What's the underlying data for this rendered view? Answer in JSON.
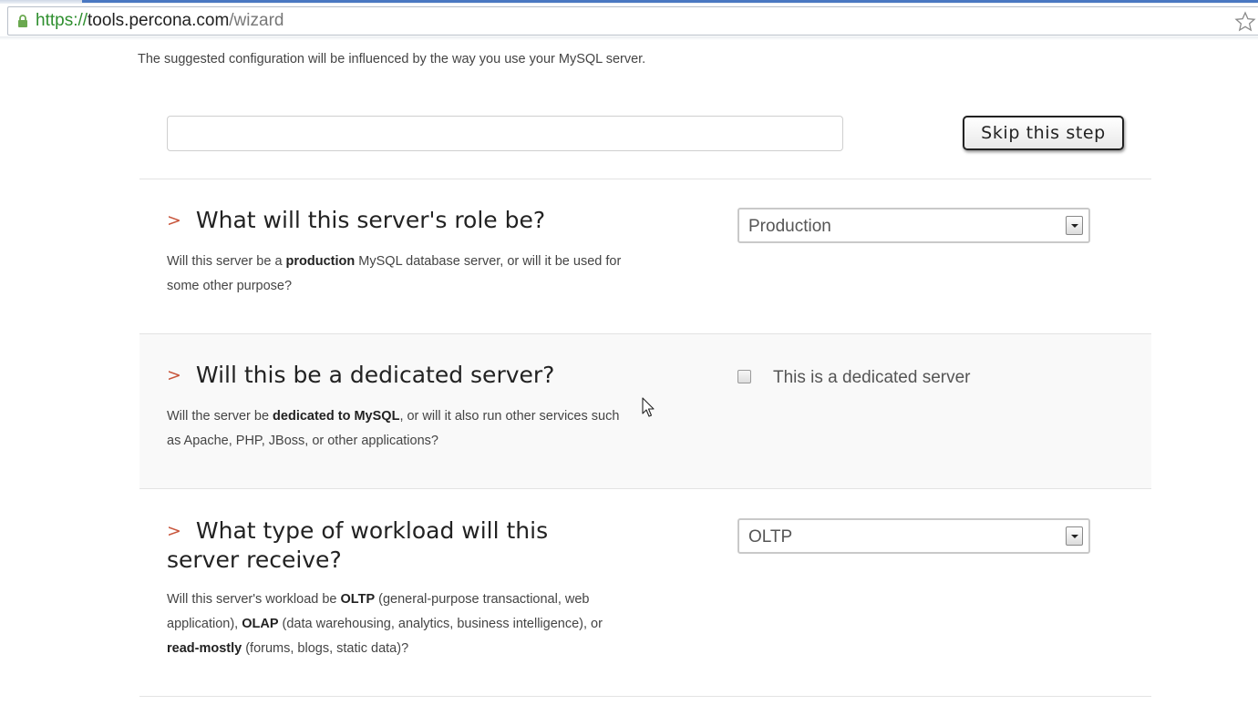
{
  "browser": {
    "url_scheme": "https://",
    "url_host": "tools.percona.com",
    "url_path": "/wizard"
  },
  "intro_text": "The suggested configuration will be influenced by the way you use your MySQL server.",
  "search": {
    "value": "",
    "placeholder": ""
  },
  "skip_button": "Skip this step",
  "sections": [
    {
      "chevron": ">",
      "title": "What will this server's role be?",
      "desc_parts": [
        "Will this server be a ",
        "production",
        " MySQL database server, or will it be used for some other purpose?"
      ],
      "control": {
        "type": "select",
        "value": "Production"
      }
    },
    {
      "chevron": ">",
      "title": "Will this be a dedicated server?",
      "desc_parts": [
        "Will the server be ",
        "dedicated to MySQL",
        ", or will it also run other services such as Apache, PHP, JBoss, or other applications?"
      ],
      "control": {
        "type": "checkbox",
        "label": "This is a dedicated server",
        "checked": false
      }
    },
    {
      "chevron": ">",
      "title": "What type of workload will this server receive?",
      "desc_parts": [
        "Will this server's workload be ",
        "OLTP",
        " (general-purpose transactional, web application), ",
        "OLAP",
        " (data warehousing, analytics, business intelligence), or ",
        "read-mostly",
        " (forums, blogs, static data)?"
      ],
      "control": {
        "type": "select",
        "value": "OLTP"
      }
    }
  ],
  "colors": {
    "chevron": "#c8553b",
    "url_scheme": "#2f8f2f",
    "alt_section_bg": "#f9f9f9"
  },
  "icons": [
    "lock-icon",
    "bookmark-star-icon",
    "dropdown-arrow-icon",
    "mouse-cursor-icon"
  ]
}
